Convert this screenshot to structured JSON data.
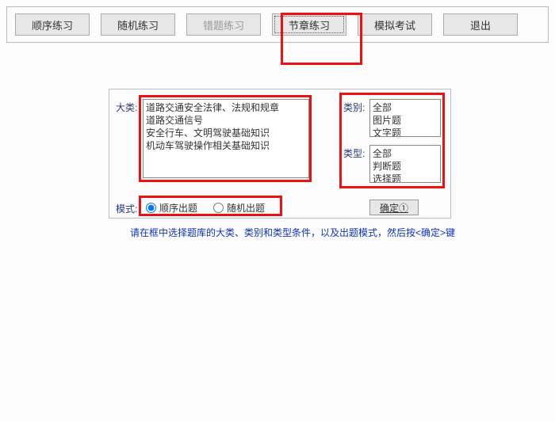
{
  "toolbar": {
    "buttons": [
      {
        "label": "顺序练习"
      },
      {
        "label": "随机练习"
      },
      {
        "label": "错题练习"
      },
      {
        "label": "节章练习"
      },
      {
        "label": "模拟考试"
      },
      {
        "label": "退出"
      }
    ]
  },
  "labels": {
    "category": "大类:",
    "kind": "类别:",
    "type": "类型:",
    "mode": "模式:"
  },
  "categoryList": {
    "items": [
      "道路交通安全法律、法规和规章",
      "道路交通信号",
      "安全行车、文明驾驶基础知识",
      "机动车驾驶操作相关基础知识"
    ]
  },
  "kindList": {
    "items": [
      "全部",
      "图片题",
      "文字题"
    ]
  },
  "typeList": {
    "items": [
      "全部",
      "判断题",
      "选择题"
    ]
  },
  "mode": {
    "sequential": "顺序出题",
    "random": "随机出题"
  },
  "confirmLabel": "确定①",
  "instruction": "请在框中选择题库的大类、类别和类型条件，以及出题模式，然后按<确定>键"
}
